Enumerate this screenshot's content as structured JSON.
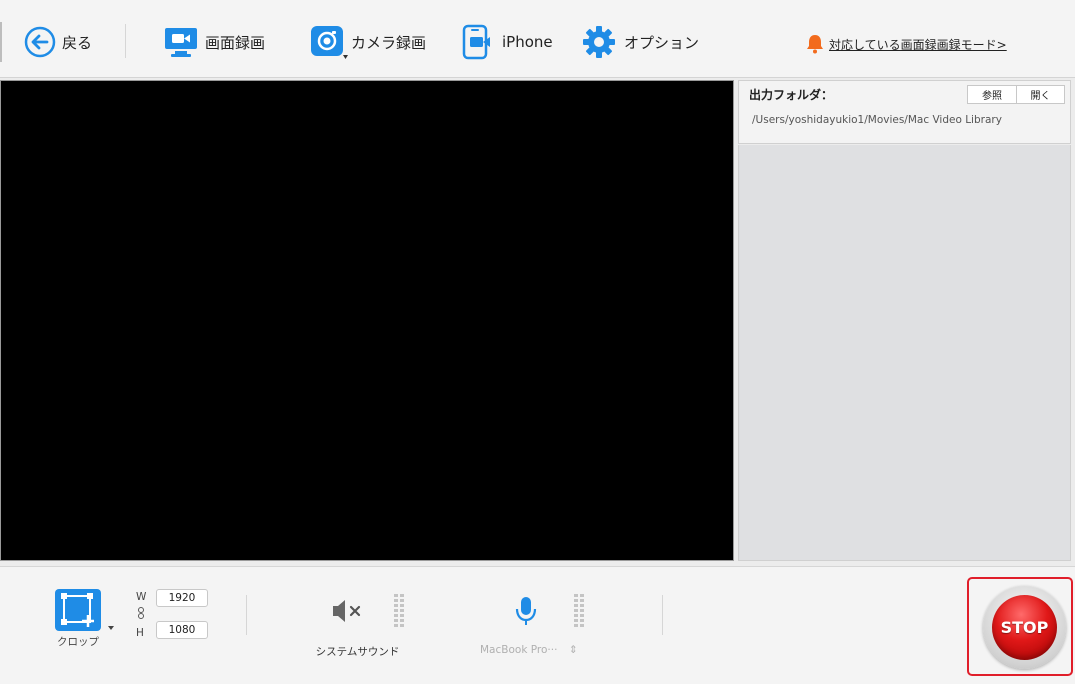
{
  "toolbar": {
    "back_label": "戻る",
    "screen_record_label": "画面録画",
    "camera_record_label": "カメラ録画",
    "iphone_label": "iPhone",
    "options_label": "オプション",
    "notice_label": "対応している画面録画録モード>"
  },
  "output": {
    "folder_label": "出力フォルダ：",
    "browse_label": "参照",
    "open_label": "開く",
    "path": "/Users/yoshidayukio1/Movies/Mac Video Library"
  },
  "bottom": {
    "crop_label": "クロップ",
    "width_label": "W",
    "width_value": "1920",
    "height_label": "H",
    "height_value": "1080",
    "system_sound_label": "システムサウンド",
    "mic_label": "MacBook Pro···",
    "mic_arrows": "⇕",
    "stop_label": "STOP"
  },
  "colors": {
    "accent": "#1f8ce6",
    "stop_red": "#e01818",
    "highlight_border": "#e01e2a"
  }
}
